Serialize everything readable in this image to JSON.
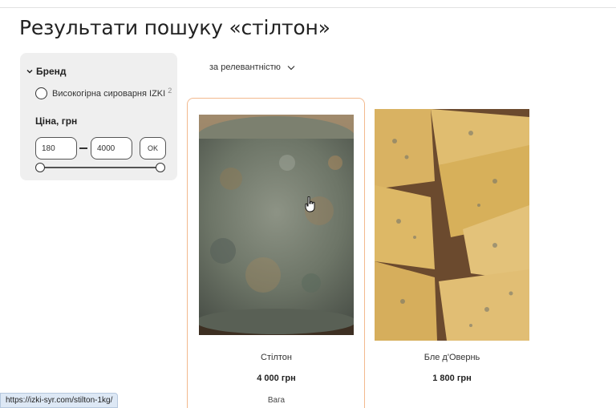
{
  "page": {
    "title": "Результати пошуку «стілтон»"
  },
  "filters": {
    "brand_heading": "Бренд",
    "brand_option_label": "Високогірна сироварня IZKI",
    "brand_option_count": "2",
    "price_heading": "Ціна, грн",
    "price_min": "180",
    "price_max": "4000",
    "ok_label": "OK",
    "slider_min_fraction": 0,
    "slider_max_fraction": 1
  },
  "sort": {
    "label": "за релевантністю"
  },
  "products": [
    {
      "name": "Стілтон",
      "price": "4 000 грн",
      "weight": "Вага"
    },
    {
      "name": "Бле д'Овернь",
      "price": "1 800 грн"
    }
  ],
  "status_bar": {
    "url": "https://izki-syr.com/stilton-1kg/"
  },
  "colors": {
    "card_border": "#f2b98e",
    "filter_panel_bg": "#efefef",
    "status_bar_bg": "#dde8f5"
  }
}
